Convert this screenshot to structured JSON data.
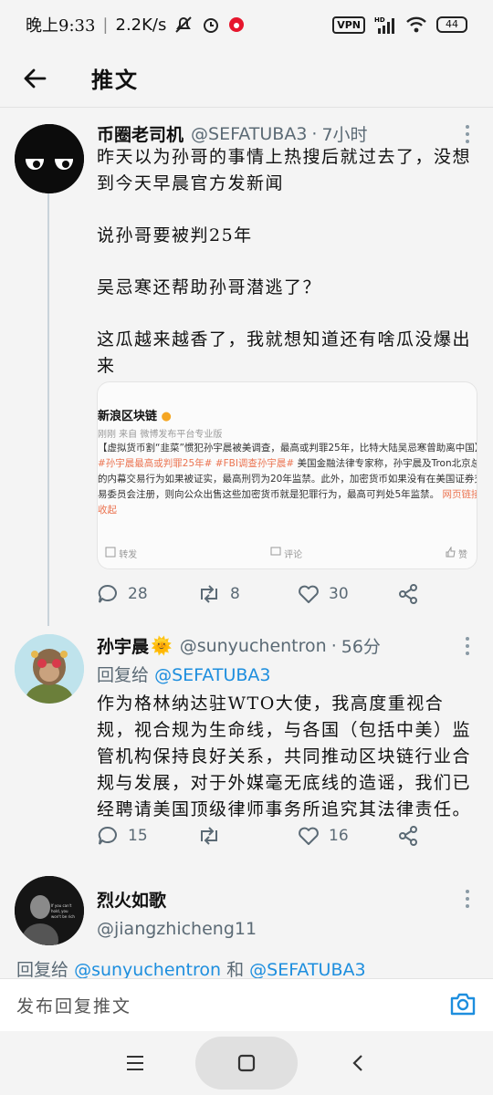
{
  "status_bar": {
    "time": "晚上9:33",
    "speed": "2.2K/s",
    "vpn": "VPN",
    "hd": "HD",
    "battery": "44"
  },
  "header": {
    "title": "推文"
  },
  "tweets": [
    {
      "name": "币圈老司机",
      "handle": "@SEFATUBA3",
      "time": "7小时",
      "text": [
        "昨天以为孙哥的事情上热搜后就过去了，没想到今天早晨官方发新闻",
        "说孙哥要被判25年",
        "吴忌寒还帮助孙哥潜逃了？",
        "这瓜越来越香了，我就想知道还有啥瓜没爆出来"
      ],
      "card": {
        "source": "新浪区块链",
        "sub": "刚刚 来自 微博发布平台专业版",
        "text_prefix": "【虚拟货币割“韭菜”惯犯孙宇晨被美调查，最高或判罪25年，比特大陆吴忌寒曾助离中国】",
        "tags": "#孙宇晨最高或判罪25年# #FBI调查孙宇晨#",
        "text_suffix": " 美国金融法律专家称，孙宇晨及Tron北京总部的内幕交易行为如果被证实，最高刑罚为20年监禁。此外，加密货币如果没有在美国证券交易委员会注册，则向公众出售这些加密货币就是犯罪行为，最高可判处5年监禁。",
        "link": "网页链接 收起",
        "actions": [
          "转发",
          "评论",
          "赞"
        ]
      },
      "replies": "28",
      "retweets": "8",
      "likes": "30"
    },
    {
      "name": "孙宇晨",
      "badge": "🌞",
      "handle": "@sunyuchentron",
      "time": "56分",
      "reply_prefix": "回复给",
      "reply_to": "@SEFATUBA3",
      "text": "作为格林纳达驻WTO大使，我高度重视合规，视合规为生命线，与各国（包括中美）监管机构保持良好关系，共同推动区块链行业合规与发展，对于外媒毫无底线的造谣，我们已经聘请美国顶级律师事务所追究其法律责任。",
      "replies": "15",
      "retweets": "",
      "likes": "16"
    },
    {
      "name": "烈火如歌",
      "handle": "@jiangzhicheng11",
      "avatar_text": "If you can't hold, you won't be rich",
      "reply_prefix": "回复给",
      "reply_to_1": "@sunyuchentron",
      "reply_and": "和",
      "reply_to_2": "@SEFATUBA3"
    }
  ],
  "reply_bar": {
    "placeholder": "发布回复推文"
  },
  "icons": {
    "back": "back-arrow-icon",
    "more": "more-vertical-icon",
    "reply": "reply-icon",
    "retweet": "retweet-icon",
    "like": "heart-icon",
    "share": "share-icon",
    "camera": "camera-icon"
  },
  "colors": {
    "accent": "#1d8ede",
    "muted": "#5b6a75",
    "weibo_highlight": "#eb7350"
  }
}
